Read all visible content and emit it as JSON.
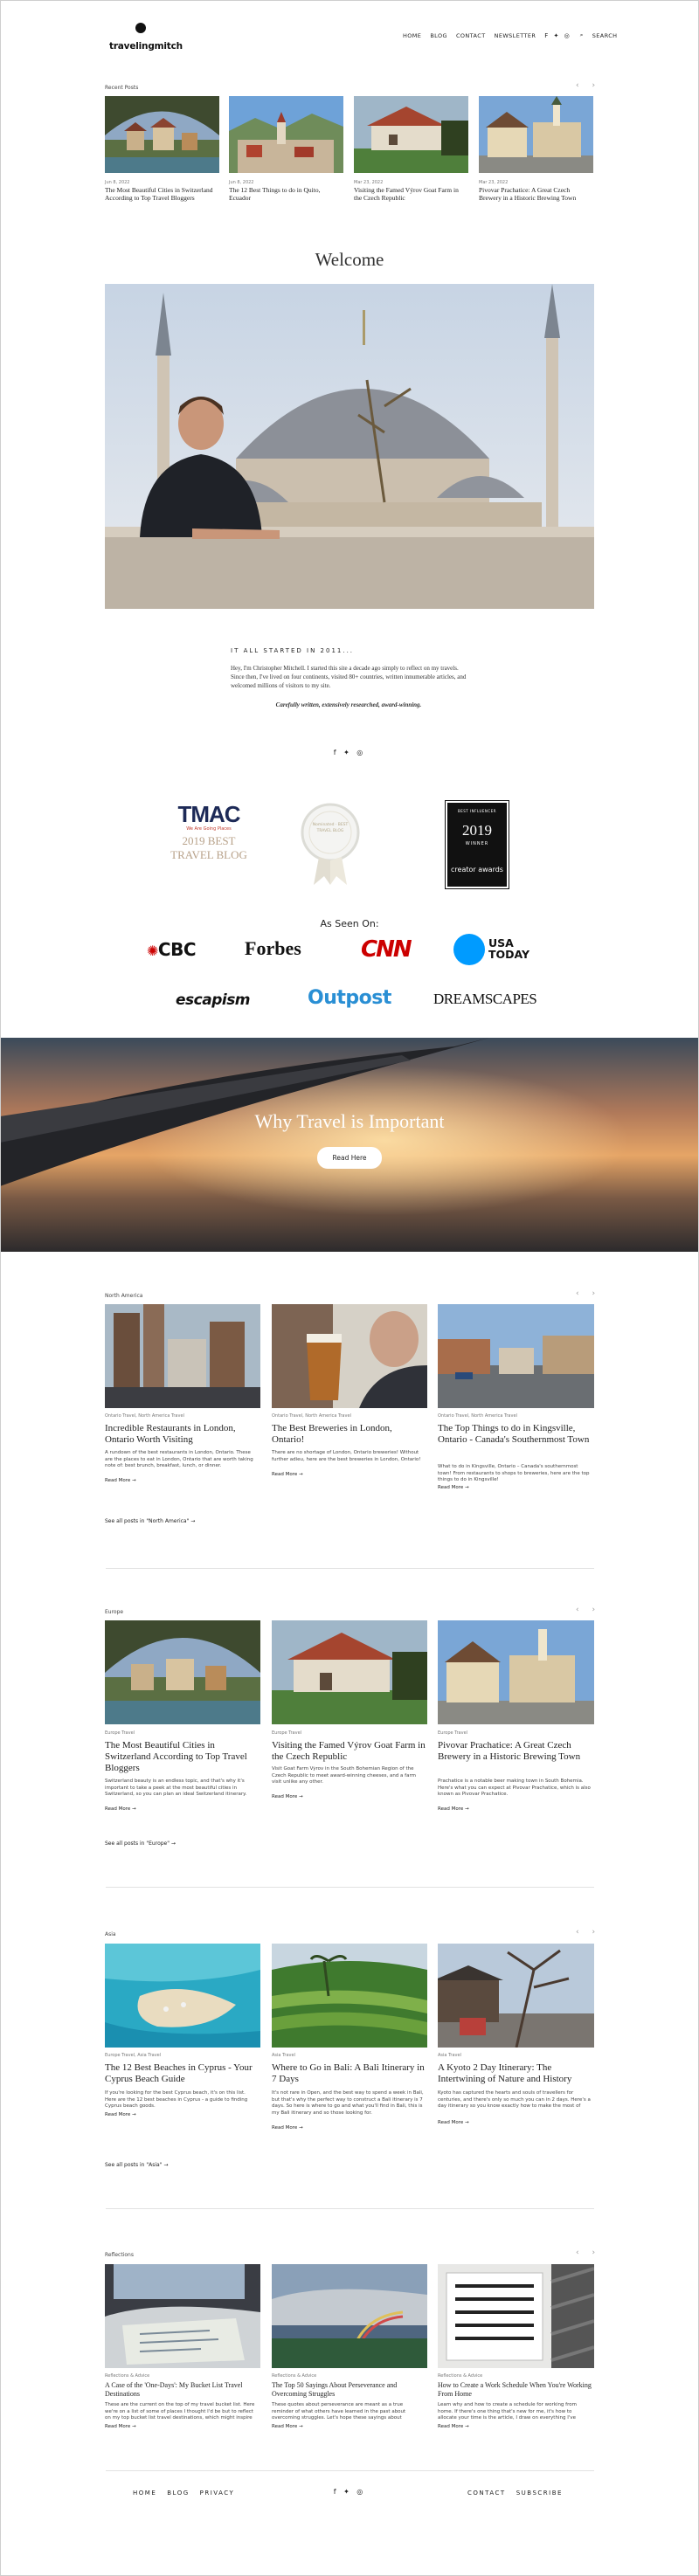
{
  "header": {
    "logo_text": "travelingmitch",
    "nav": [
      "HOME",
      "BLOG",
      "CONTACT",
      "NEWSLETTER"
    ],
    "social_icons": "f ✦ ◎",
    "search_label": "SEARCH"
  },
  "recent": {
    "label": "Recent Posts",
    "posts": [
      {
        "date": "Jun 8, 2022",
        "title": "The Most Beautiful Cities in Switzerland According to Top Travel Bloggers"
      },
      {
        "date": "Jun 8, 2022",
        "title": "The 12 Best Things to do in Quito, Ecuador"
      },
      {
        "date": "Mar 23, 2022",
        "title": "Visiting the Famed Výrov Goat Farm in the Czech Republic"
      },
      {
        "date": "Mar 23, 2022",
        "title": "Pivovar Prachatice: A Great Czech Brewery in a Historic Brewing Town"
      }
    ]
  },
  "welcome": {
    "heading": "Welcome",
    "intro_title": "IT ALL STARTED IN 2011...",
    "intro_text": "Hey, I'm Christopher Mitchell. I started this site a decade ago simply to reflect on my travels. Since then, I've lived on four continents, visited 80+ countries, written innumerable articles, and welcomed millions of visitors to my site.",
    "tagline": "Carefully written, extensively researched, award-winning.",
    "social": "f ✦ ◎"
  },
  "awards": {
    "tmac_text": "TMAC",
    "tmac_sub": "We Are Going Places",
    "tmac_year": "2019 BEST",
    "tmac_label": "TRAVEL BLOG",
    "medal_text": "Nominated · BEST TRAVEL BLOG",
    "cc_top": "BEST INFLUENCER",
    "cc_year": "2019",
    "cc_winner": "WINNER",
    "cc_label": "creator awards"
  },
  "as_seen_on": {
    "heading": "As Seen On:",
    "logos": [
      "CBC",
      "Forbes",
      "CNN",
      "USA TODAY",
      "escapism",
      "Outpost",
      "DREAMSCAPES"
    ]
  },
  "banner": {
    "title": "Why Travel is Important",
    "button": "Read Here"
  },
  "sections": [
    {
      "label": "North America",
      "see_all": "See all posts in \"North America\" →",
      "posts": [
        {
          "meta": "Ontario Travel, North America Travel",
          "title": "Incredible Restaurants in London, Ontario Worth Visiting",
          "excerpt": "A rundown of the best restaurants in London, Ontario. These are the places to eat in London, Ontario that are worth taking note of: best brunch, breakfast, lunch, or dinner.",
          "more": "Read More →"
        },
        {
          "meta": "Ontario Travel, North America Travel",
          "title": "The Best Breweries in London, Ontario!",
          "excerpt": "There are no shortage of London, Ontario breweries! Without further adieu, here are the best breweries in London, Ontario!",
          "more": "Read More →"
        },
        {
          "meta": "Ontario Travel, North America Travel",
          "title": "The Top Things to do in Kingsville, Ontario - Canada's Southernmost Town",
          "excerpt": "What to do in Kingsville, Ontario – Canada's southernmost town! From restaurants to shops to breweries, here are the top things to do in Kingsville!",
          "more": "Read More →"
        }
      ]
    },
    {
      "label": "Europe",
      "see_all": "See all posts in \"Europe\" →",
      "posts": [
        {
          "meta": "Europe Travel",
          "title": "The Most Beautiful Cities in Switzerland According to Top Travel Bloggers",
          "excerpt": "Switzerland beauty is an endless topic, and that's why it's important to take a peek at the most beautiful cities in Switzerland, so you can plan an ideal Switzerland itinerary.",
          "more": "Read More →"
        },
        {
          "meta": "Europe Travel",
          "title": "Visiting the Famed Výrov Goat Farm in the Czech Republic",
          "excerpt": "Visit Goat Farm Výrov in the South Bohemian Region of the Czech Republic to meet award-winning cheeses, and a farm visit unlike any other.",
          "more": "Read More →"
        },
        {
          "meta": "Europe Travel",
          "title": "Pivovar Prachatice: A Great Czech Brewery in a Historic Brewing Town",
          "excerpt": "Prachatice is a notable beer making town in South Bohemia. Here's what you can expect at Pivovar Prachatice, which is also known as Pivovar Prachatice.",
          "more": "Read More →"
        }
      ]
    },
    {
      "label": "Asia",
      "see_all": "See all posts in \"Asia\" →",
      "posts": [
        {
          "meta": "Europe Travel, Asia Travel",
          "title": "The 12 Best Beaches in Cyprus - Your Cyprus Beach Guide",
          "excerpt": "If you're looking for the best Cyprus beach, it's on this list. Here are the 12 best beaches in Cyprus - a guide to finding Cyprus beach goods.",
          "more": "Read More →"
        },
        {
          "meta": "Asia Travel",
          "title": "Where to Go in Bali: A Bali Itinerary in 7 Days",
          "excerpt": "It's not rare in Open, and the best way to spend a week in Bali, but that's why the perfect way to construct a Bali itinerary is 7 days. So here is where to go and what you'll find in Bali, this is my Bali itinerary and so those looking for.",
          "more": "Read More →"
        },
        {
          "meta": "Asia Travel",
          "title": "A Kyoto 2 Day Itinerary: The Intertwining of Nature and History",
          "excerpt": "Kyoto has captured the hearts and souls of travellers for centuries, and there's only so much you can in 2 days. Here's a day itinerary so you know exactly how to make the most of your time.",
          "more": "Read More →"
        }
      ]
    },
    {
      "label": "Reflections",
      "see_all": "",
      "posts": [
        {
          "meta": "Reflections & Advice",
          "title": "A Case of the 'One-Days': My Bucket List Travel Destinations",
          "excerpt": "These are the current on the top of my travel bucket list. Here we're on a list of some of places I thought I'd be but to reflect on my top bucket list travel destinations, which might inspire you to do the same!",
          "more": "Read More →"
        },
        {
          "meta": "Reflections & Advice",
          "title": "The Top 50 Sayings About Perseverance and Overcoming Struggles",
          "excerpt": "These quotes about perseverance are meant as a true reminder of what others have learned in the past about overcoming struggles. Let's hope these sayings about perseverance serve to give you the boost you may need right now.",
          "more": "Read More →"
        },
        {
          "meta": "Reflections & Advice",
          "title": "How to Create a Work Schedule When You're Working From Home",
          "excerpt": "Learn why and how to create a schedule for working from home. If there's one thing that's new for me, it's how to allocate your time is the article, I draw on everything I've learned about how to create a work schedule once I started working from home.",
          "more": "Read More →"
        }
      ]
    }
  ],
  "footer": {
    "left": [
      "HOME",
      "BLOG",
      "PRIVACY"
    ],
    "social": "f ✦ ◎",
    "right": [
      "CONTACT",
      "SUBSCRIBE"
    ]
  },
  "colors": {
    "accent_red": "#cc0000",
    "usatoday_blue": "#009bff",
    "outpost_blue": "#2a8fd4"
  }
}
